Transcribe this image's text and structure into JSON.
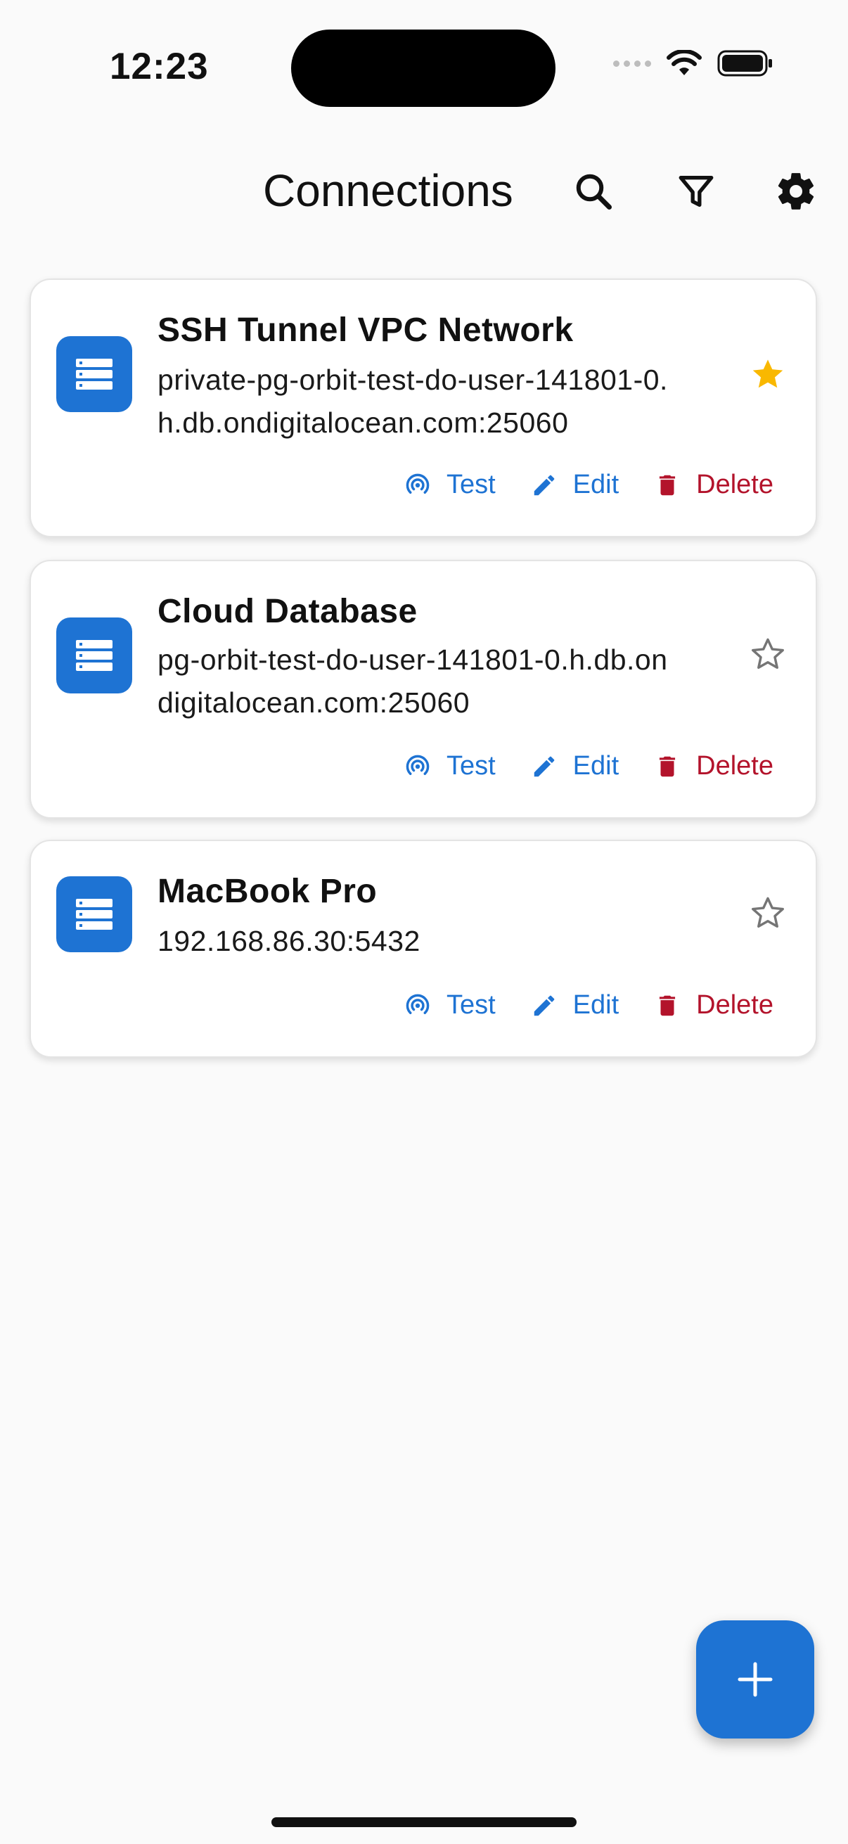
{
  "status_bar": {
    "time": "12:23"
  },
  "app_bar": {
    "title": "Connections",
    "icons": [
      "search-icon",
      "filter-icon",
      "settings-icon"
    ]
  },
  "connections": [
    {
      "name": "SSH Tunnel VPC Network",
      "host_line1": "private-pg-orbit-test-do-user-141801-0.",
      "host_line2": "h.db.ondigitalocean.com:25060",
      "favorite": true
    },
    {
      "name": "Cloud Database",
      "host_line1": "pg-orbit-test-do-user-141801-0.h.db.on",
      "host_line2": "digitalocean.com:25060",
      "favorite": false
    },
    {
      "name": "MacBook Pro",
      "host_line1": "192.168.86.30:5432",
      "host_line2": "",
      "favorite": false
    }
  ],
  "actions": {
    "test": "Test",
    "edit": "Edit",
    "delete": "Delete"
  },
  "colors": {
    "accent": "#1e73d3",
    "danger": "#b3132b",
    "star": "#f9b800"
  },
  "fab": {
    "icon": "plus-icon"
  }
}
